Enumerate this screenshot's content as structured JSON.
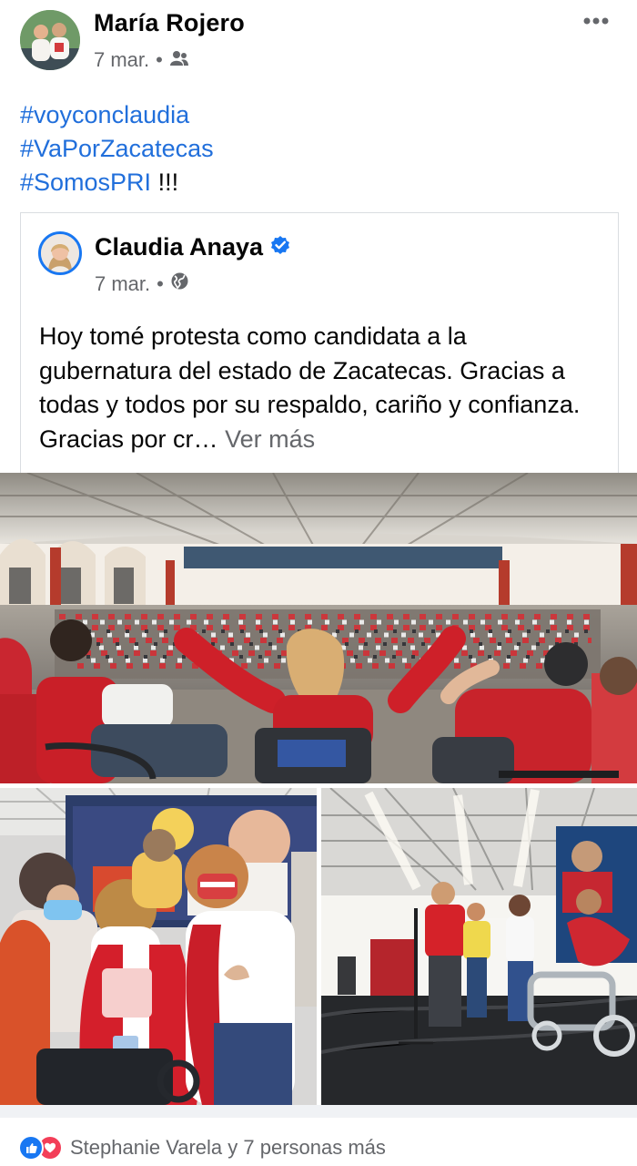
{
  "post": {
    "author": "María Rojero",
    "date": "7 mar.",
    "dot": "•",
    "audience_icon": "friends-icon",
    "hashtags": [
      "#voyconclaudia",
      "#VaPorZacatecas",
      "#SomosPRI"
    ],
    "hashtag_suffix": " !!!"
  },
  "shared": {
    "author": "Claudia Anaya",
    "verified_icon": "verified-badge-icon",
    "date": "7 mar.",
    "dot": "•",
    "audience_icon": "globe-icon",
    "text": "Hoy tomé protesta como candidata a la gubernatura del estado de Zacatecas. Gracias a todas y todos por su respaldo, cariño y confianza. Gracias por cr…",
    "see_more": "Ver más"
  },
  "photos": [
    "main-event-photo",
    "group-photo-left",
    "stage-photo-right"
  ],
  "reactions": {
    "icons": [
      "like-icon",
      "love-icon"
    ],
    "summary": "Stephanie Varela y 7 personas más"
  },
  "colors": {
    "link": "#216fdb",
    "secondary_text": "#65676b",
    "brand_blue": "#1877f2",
    "red_shirt": "#d71f27"
  }
}
